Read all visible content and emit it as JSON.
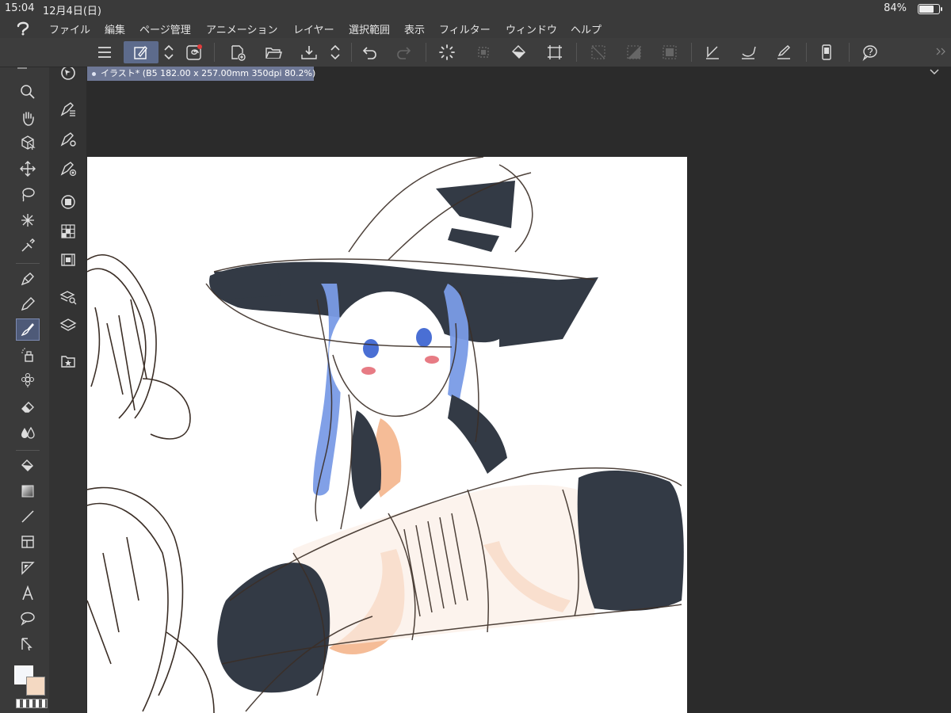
{
  "status": {
    "time": "15:04",
    "date": "12月4日(日)",
    "battery_text": "84%",
    "battery_level": 0.84
  },
  "menu": [
    {
      "id": "file",
      "label": "ファイル"
    },
    {
      "id": "edit",
      "label": "編集"
    },
    {
      "id": "page",
      "label": "ページ管理"
    },
    {
      "id": "animation",
      "label": "アニメーション"
    },
    {
      "id": "layer",
      "label": "レイヤー"
    },
    {
      "id": "selection",
      "label": "選択範囲"
    },
    {
      "id": "view",
      "label": "表示"
    },
    {
      "id": "filter",
      "label": "フィルター"
    },
    {
      "id": "window",
      "label": "ウィンドウ"
    },
    {
      "id": "help",
      "label": "ヘルプ"
    }
  ],
  "document_tab": {
    "label": "イラスト* (B5 182.00 x 257.00mm 350dpi 80.2%)"
  },
  "colors": {
    "main": "#f4f6fa",
    "sub": "#f4d9c2",
    "accent": "#5d6b8c"
  },
  "toolbar_icons": [
    "menu-icon",
    "pen-settings-icon",
    "updown-arrows-icon",
    "spiral-icon",
    "new-file-icon",
    "open-folder-icon",
    "save-icon",
    "updown-arrows-icon",
    "undo-icon",
    "redo-icon",
    "loading-icon",
    "transform-disabled-icon",
    "fill-icon",
    "crop-icon",
    "clear-icon",
    "deselect-icon",
    "select-all-icon",
    "pen-line-icon",
    "brush-line-icon",
    "pencil-line-icon",
    "device-icon",
    "help-icon"
  ],
  "left_tools": [
    "zoom-icon",
    "hand-icon",
    "object-icon",
    "move-icon",
    "lasso-icon",
    "wand-icon",
    "eyedropper-icon",
    "pen-icon",
    "pencil-icon",
    "brush-icon",
    "airbrush-icon",
    "decoration-icon",
    "eraser-icon",
    "blend-icon",
    "fill-icon",
    "gradient-icon",
    "line-icon",
    "frame-icon",
    "ruler-icon",
    "text-icon",
    "balloon-icon",
    "correct-line-icon"
  ],
  "sub_tools": [
    "navigator-icon",
    "sub-tool-a-icon",
    "sub-tool-b-icon",
    "sub-tool-c-icon",
    "layer-property-icon",
    "color-set-icon",
    "film-icon",
    "layer-search-icon",
    "layers-icon",
    "material-icon"
  ]
}
